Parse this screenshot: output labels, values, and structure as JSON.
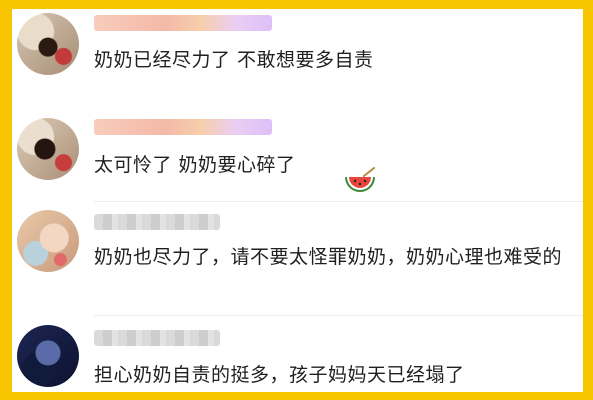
{
  "comments": [
    {
      "text": "奶奶已经尽力了   不敢想要多自责"
    },
    {
      "text": "太可怜了   奶奶要心碎了"
    },
    {
      "text": "奶奶也尽力了，请不要太怪罪奶奶，奶奶心理也难受的"
    },
    {
      "text": "担心奶奶自责的挺多，孩子妈妈天已经塌了"
    }
  ],
  "icons": {
    "reaction_emoji": "watermelon-icon"
  },
  "colors": {
    "frame_border": "#f7c600",
    "background": "#ffffff",
    "text": "#1f1f1f"
  }
}
